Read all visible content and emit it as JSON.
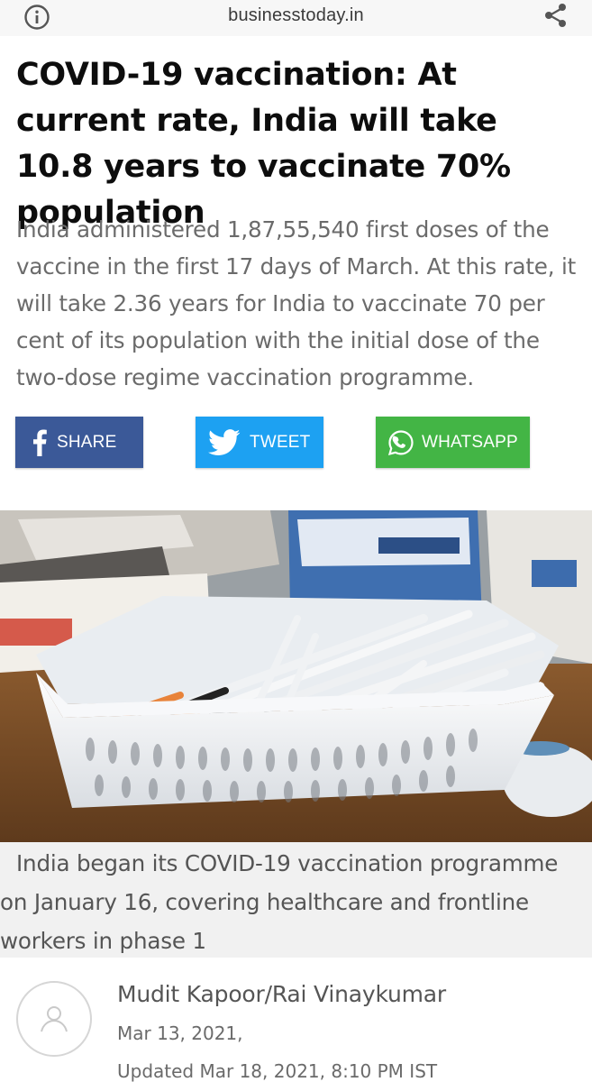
{
  "browser": {
    "domain": "businesstoday.in",
    "info_icon": "info-circle-icon",
    "share_icon": "share-icon"
  },
  "article": {
    "headline": "COVID-19 vaccination: At current rate, India will take 10.8 years to vaccinate 70% population",
    "summary": "India administered 1,87,55,540 first doses of the vaccine in the first 17 days of March. At this rate, it will take 2.36 years for India to vaccinate 70 per cent of its population with the initial dose of the two-dose regime vaccination programme.",
    "image_caption": "India began its COVID-19 vaccination programme on January 16, covering healthcare and frontline workers in phase 1",
    "author": "Mudit Kapoor/Rai Vinaykumar",
    "date": "Mar 13, 2021,",
    "updated": "Updated Mar 18, 2021, 8:10 PM IST"
  },
  "social": {
    "facebook_label": "SHARE",
    "twitter_label": "TWEET",
    "whatsapp_label": "WHATSAPP",
    "facebook_color": "#3b5998",
    "twitter_color": "#1da1f2",
    "whatsapp_color": "#43b545"
  }
}
